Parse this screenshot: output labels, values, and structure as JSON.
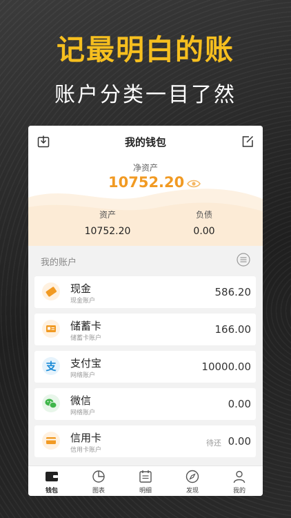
{
  "promo": {
    "headline": "记最明白的账",
    "subline": "账户分类一目了然"
  },
  "wallet": {
    "title": "我的钱包",
    "net_label": "净资产",
    "net_value": "10752.20",
    "assets_label": "资产",
    "assets_value": "10752.20",
    "debt_label": "负债",
    "debt_value": "0.00"
  },
  "accounts": {
    "section_title": "我的账户",
    "items": [
      {
        "name": "现金",
        "sub": "现金账户",
        "amount": "586.20",
        "note": "",
        "icon": "cash-icon",
        "color": "#f19a23"
      },
      {
        "name": "储蓄卡",
        "sub": "储蓄卡账户",
        "amount": "166.00",
        "note": "",
        "icon": "savings-card-icon",
        "color": "#f19a23"
      },
      {
        "name": "支付宝",
        "sub": "网络账户",
        "amount": "10000.00",
        "note": "",
        "icon": "alipay-icon",
        "color": "#1a8ad6"
      },
      {
        "name": "微信",
        "sub": "网络账户",
        "amount": "0.00",
        "note": "",
        "icon": "wechat-icon",
        "color": "#3fb64a"
      },
      {
        "name": "信用卡",
        "sub": "信用卡账户",
        "amount": "0.00",
        "note": "待还",
        "icon": "credit-card-icon",
        "color": "#f19a23"
      }
    ]
  },
  "tabs": [
    {
      "label": "钱包",
      "icon": "wallet-icon",
      "active": true
    },
    {
      "label": "图表",
      "icon": "pie-chart-icon",
      "active": false
    },
    {
      "label": "明细",
      "icon": "calendar-icon",
      "active": false
    },
    {
      "label": "发现",
      "icon": "compass-icon",
      "active": false
    },
    {
      "label": "我的",
      "icon": "user-icon",
      "active": false
    }
  ],
  "colors": {
    "accent": "#f6bf1f",
    "net_value": "#f19a23",
    "background": "#2a2a2a"
  }
}
